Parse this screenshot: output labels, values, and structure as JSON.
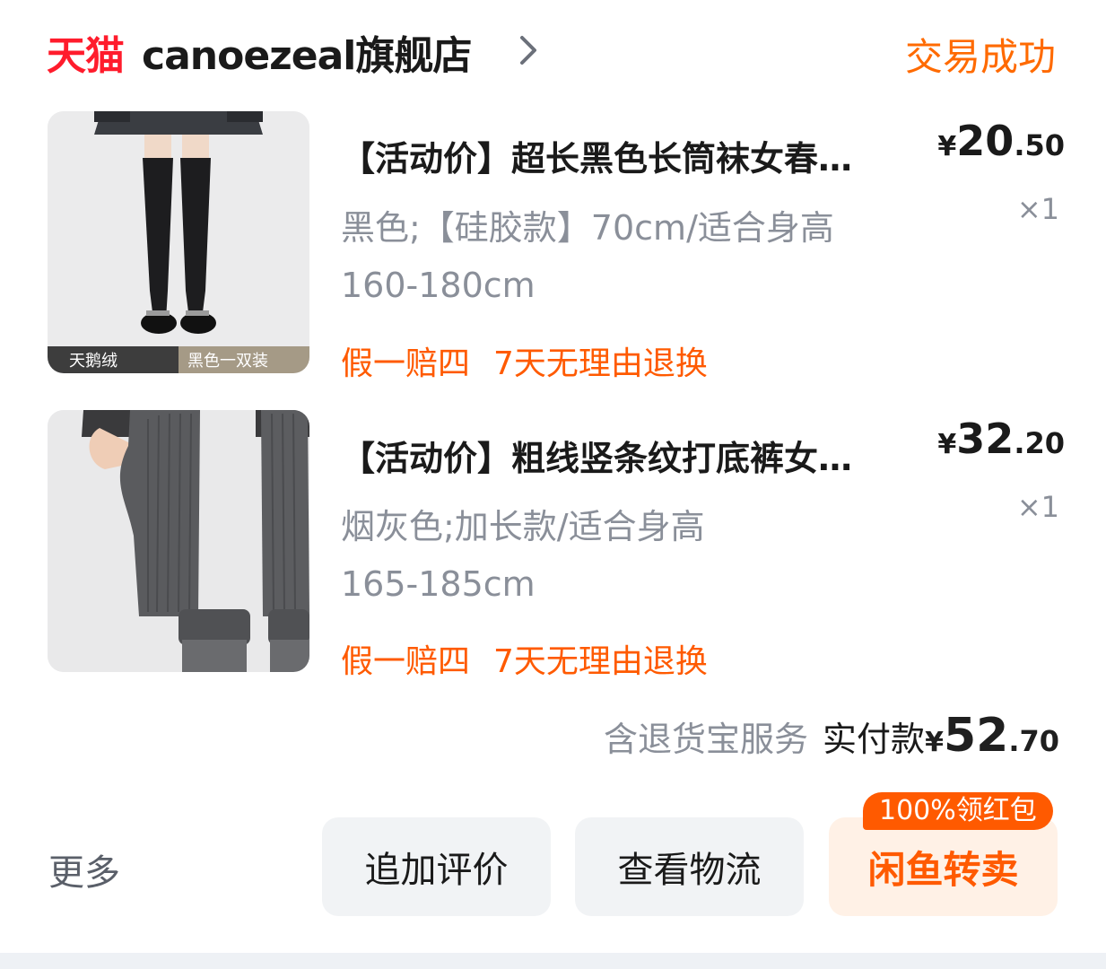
{
  "header": {
    "platform": "天猫",
    "shop_name": "canoezeal旗舰店",
    "status": "交易成功"
  },
  "products": [
    {
      "image_caption_left": "天鹅绒",
      "image_caption_right": "黑色一双装",
      "title": "【活动价】超长黑色长筒袜女春…",
      "spec_line1": "黑色;【硅胶款】70cm/适合身高",
      "spec_line2": "160-180cm",
      "tags": [
        "假一赔四",
        "7天无理由退换"
      ],
      "price_currency": "¥",
      "price_int": "20",
      "price_dec": ".50",
      "qty": "×1"
    },
    {
      "title": "【活动价】粗线竖条纹打底裤女…",
      "spec_line1": "烟灰色;加长款/适合身高",
      "spec_line2": "165-185cm",
      "tags": [
        "假一赔四",
        "7天无理由退换"
      ],
      "price_currency": "¥",
      "price_int": "32",
      "price_dec": ".20",
      "qty": "×1"
    }
  ],
  "summary": {
    "service": "含退货宝服务",
    "label": "实付款",
    "currency": "¥",
    "int": "52",
    "dec": ".70"
  },
  "actions": {
    "more": "更多",
    "review": "追加评价",
    "logistics": "查看物流",
    "resell": "闲鱼转卖",
    "resell_badge": "100%领红包"
  },
  "colors": {
    "tmall_red": "#ff1c2c",
    "accent_orange": "#ff6a00",
    "muted_text": "#8a8f99"
  }
}
